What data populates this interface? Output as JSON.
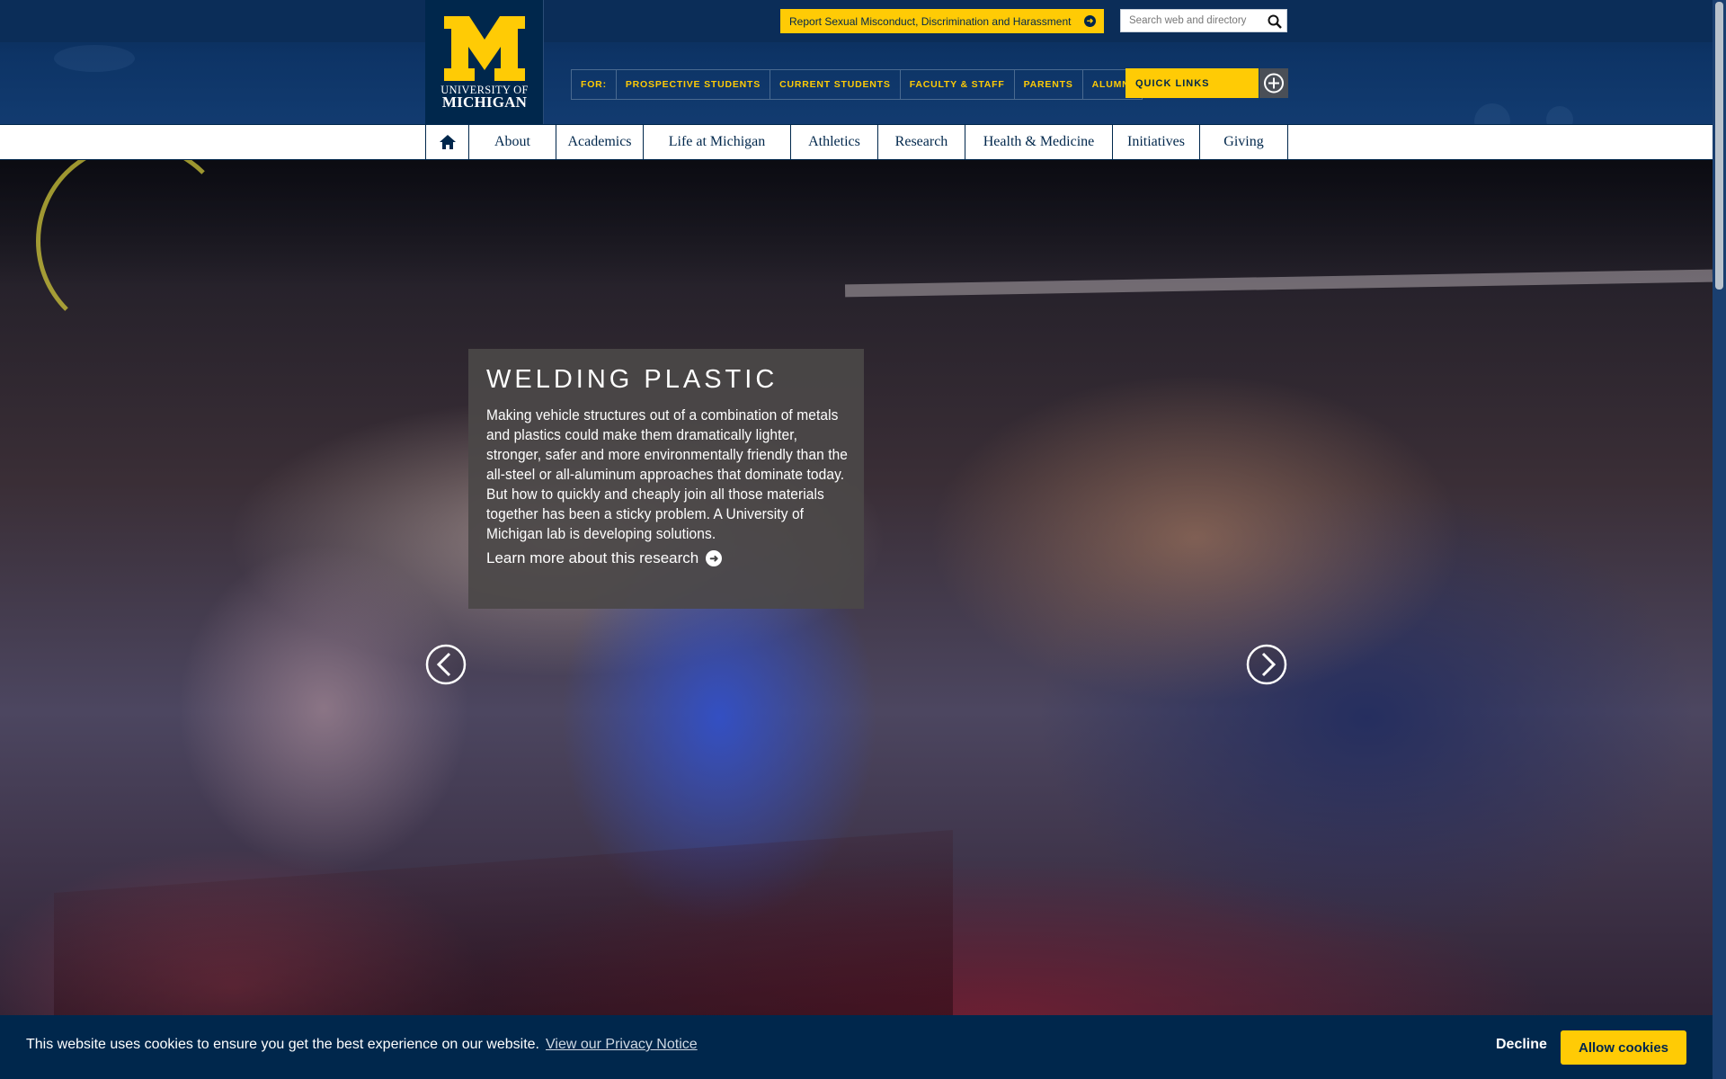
{
  "brand": {
    "logo_line1": "UNIVERSITY OF",
    "logo_line2": "MICHIGAN",
    "colors": {
      "maize": "#ffcb05",
      "blue": "#00274c"
    }
  },
  "header": {
    "report_label": "Report Sexual Misconduct, Discrimination and Harassment",
    "search_placeholder": "Search web and directory",
    "audience": {
      "lead": "FOR:",
      "items": [
        "PROSPECTIVE STUDENTS",
        "CURRENT STUDENTS",
        "FACULTY & STAFF",
        "PARENTS",
        "ALUMNI"
      ]
    },
    "quick_links": "QUICK LINKS"
  },
  "nav": {
    "home_icon": "home-icon",
    "items": [
      "About",
      "Academics",
      "Life at Michigan",
      "Athletics",
      "Research",
      "Health & Medicine",
      "Initiatives",
      "Giving"
    ]
  },
  "hero": {
    "title": "WELDING PLASTIC",
    "body": "Making vehicle structures out of a combination of metals and plastics could make them dramatically lighter, stronger, safer and more environmentally friendly than the all-steel or all-aluminum approaches that dominate today. But how to quickly and cheaply join all those materials together has been a sticky problem. A University of Michigan lab is developing solutions.",
    "link": "Learn more about this research",
    "prev_icon": "chevron-left-icon",
    "next_icon": "chevron-right-icon"
  },
  "cookie": {
    "message": "This website uses cookies to ensure you get the best experience on our website.",
    "link": "View our Privacy Notice",
    "decline": "Decline",
    "allow": "Allow cookies"
  }
}
